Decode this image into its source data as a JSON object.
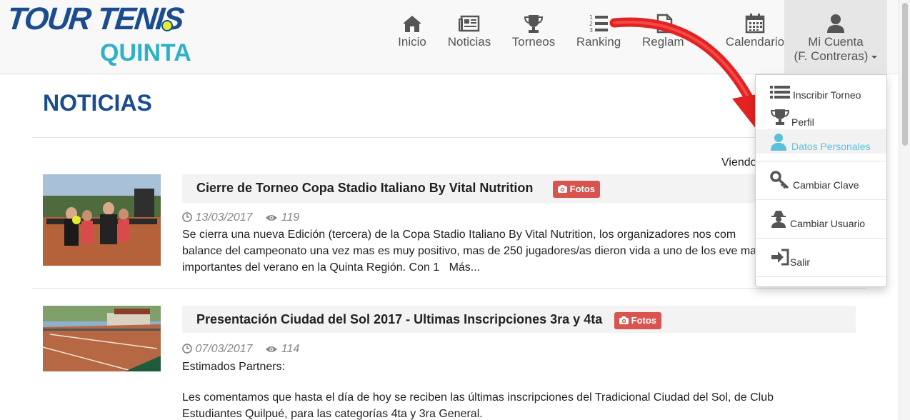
{
  "logo": {
    "line1": "TOUR TENIS",
    "line2": "QUINTA"
  },
  "nav": {
    "items": [
      {
        "label": "Inicio",
        "icon": "home-icon"
      },
      {
        "label": "Noticias",
        "icon": "newspaper-icon"
      },
      {
        "label": "Torneos",
        "icon": "trophy-icon"
      },
      {
        "label": "Ranking",
        "icon": "ordered-list-icon"
      },
      {
        "label": "Reglam",
        "icon": "document-icon"
      },
      {
        "label": "Calendario",
        "icon": "calendar-icon"
      }
    ],
    "account": {
      "label": "Mi Cuenta",
      "user": "(F. Contreras)",
      "icon": "user-icon"
    }
  },
  "dropdown": {
    "items": [
      {
        "label": "Inscribir Torneo",
        "icon": "list-icon"
      },
      {
        "label": "Perfil",
        "icon": "trophy-icon"
      },
      {
        "label": "Datos Personales",
        "icon": "user-icon",
        "active": true
      },
      {
        "label": "Cambiar Clave",
        "icon": "key-icon"
      },
      {
        "label": "Cambiar Usuario",
        "icon": "user-secret-icon"
      },
      {
        "label": "Salir",
        "icon": "sign-in-icon"
      }
    ]
  },
  "page": {
    "title": "NOTICIAS",
    "viendo": "Viendo"
  },
  "news": [
    {
      "title": "Cierre de Torneo Copa Stadio Italiano By Vital Nutrition",
      "badge": "Fotos",
      "date": "13/03/2017",
      "views": "119",
      "excerpt": "Se cierra una nueva Edición (tercera) de la Copa Stadio Italiano By Vital Nutrition, los organizadores nos com balance del campeonato una vez mas es muy positivo, mas de 250 jugadores/as dieron vida a uno de los eve mas importantes del verano en la Quinta Región. Con 1",
      "more": "Más..."
    },
    {
      "title": "Presentación Ciudad del Sol 2017 - Ultimas Inscripciones 3ra y 4ta",
      "badge": "Fotos",
      "date": "07/03/2017",
      "views": "114",
      "excerpt1": "Estimados Partners:",
      "excerpt2": "Les comentamos que hasta el día de hoy se reciben las últimas inscripciones del Tradicional Ciudad del Sol, de Club Estudiantes Quilpué, para las categorías 4ta y 3ra General."
    }
  ],
  "colors": {
    "brand": "#1b4d8e",
    "accent": "#2fb1c8",
    "badge": "#d9534f",
    "arrow": "#e32222"
  }
}
